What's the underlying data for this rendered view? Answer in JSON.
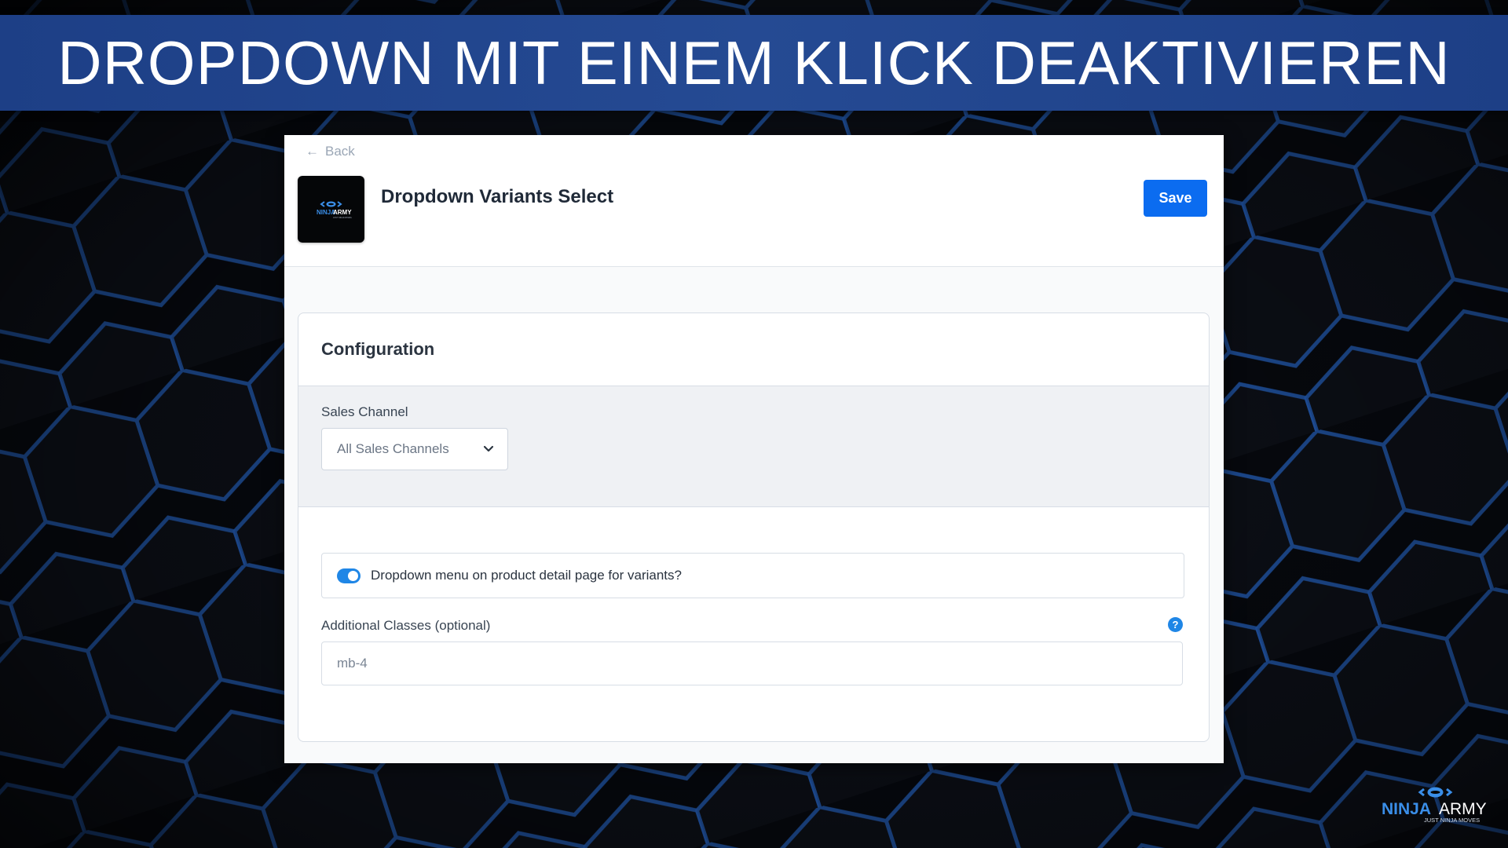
{
  "banner": {
    "title": "DROPDOWN MIT EINEM KLICK DEAKTIVIEREN"
  },
  "header": {
    "back_label": "Back",
    "back_icon": "arrow-left-icon",
    "app_title": "Dropdown Variants Select",
    "save_label": "Save",
    "logo": {
      "brand_word_1": "NINJA",
      "brand_word_2": "ARMY",
      "tagline": "JUST NINJA MOVES"
    }
  },
  "configuration": {
    "title": "Configuration",
    "sales_channel": {
      "label": "Sales Channel",
      "selected": "All Sales Channels"
    },
    "toggle": {
      "label": "Dropdown menu on product detail page for variants?",
      "enabled": true
    },
    "additional_classes": {
      "label": "Additional Classes (optional)",
      "placeholder": "mb-4",
      "value": "",
      "help_icon": "?"
    }
  },
  "corner_brand": {
    "brand_word_1": "NINJA",
    "brand_word_2": "ARMY",
    "tagline": "JUST NINJA MOVES"
  },
  "colors": {
    "banner": "#254a93",
    "primary_button": "#0b6cf0",
    "toggle_on": "#1f86e6",
    "brand_blue": "#3a8ee8"
  }
}
